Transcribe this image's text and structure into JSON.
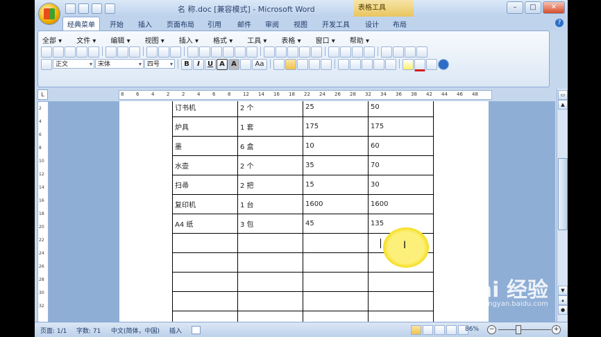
{
  "window": {
    "title": "名 称.doc [兼容模式] - Microsoft Word",
    "context_tab": "表格工具",
    "win_minimize": "–",
    "win_maximize": "□",
    "win_close": "✕"
  },
  "tabs": [
    "经典菜单",
    "开始",
    "插入",
    "页面布局",
    "引用",
    "邮件",
    "审阅",
    "视图",
    "开发工具",
    "设计",
    "布局"
  ],
  "menu": [
    "全部 ▾",
    "文件 ▾",
    "编辑 ▾",
    "视图 ▾",
    "插入 ▾",
    "格式 ▾",
    "工具 ▾",
    "表格 ▾",
    "窗口 ▾",
    "帮助 ▾"
  ],
  "format": {
    "style": "正文",
    "font": "宋体",
    "size": "四号",
    "bold": "B",
    "italic": "I",
    "underline": "U",
    "border_a": "A",
    "shade_a": "A",
    "aa": "Aa"
  },
  "ruler_ticks": [
    "8",
    "6",
    "4",
    "2",
    "2",
    "4",
    "6",
    "8",
    "12",
    "14",
    "16",
    "18",
    "22",
    "24",
    "26",
    "28",
    "32",
    "34",
    "36",
    "38",
    "42",
    "44",
    "46",
    "48"
  ],
  "vruler_ticks": [
    "2",
    "4",
    "6",
    "8",
    "10",
    "12",
    "14",
    "16",
    "18",
    "20",
    "22",
    "24",
    "26",
    "28",
    "30",
    "32"
  ],
  "table": {
    "rows": [
      [
        "订书机",
        "2 个",
        "25",
        "50"
      ],
      [
        "炉具",
        "1 套",
        "175",
        "175"
      ],
      [
        "墨",
        "6 盒",
        "10",
        "60"
      ],
      [
        "水壶",
        "2 个",
        "35",
        "70"
      ],
      [
        "扫帚",
        "2 把",
        "15",
        "30"
      ],
      [
        "复印机",
        "1 台",
        "1600",
        "1600"
      ],
      [
        "A4 纸",
        "3 包",
        "45",
        "135"
      ],
      [
        "",
        "",
        "",
        ""
      ],
      [
        "",
        "",
        "",
        ""
      ],
      [
        "",
        "",
        "",
        ""
      ],
      [
        "",
        "",
        "",
        ""
      ],
      [
        "",
        "",
        "",
        ""
      ]
    ]
  },
  "status": {
    "page": "页面: 1/1",
    "words": "字数: 71",
    "language": "中文(简体，中国)",
    "mode": "插入",
    "zoom": "86%",
    "zoom_minus": "−",
    "zoom_plus": "+"
  },
  "watermark": {
    "text": "Bai 经验",
    "sub": "jingyan.baidu.com"
  }
}
